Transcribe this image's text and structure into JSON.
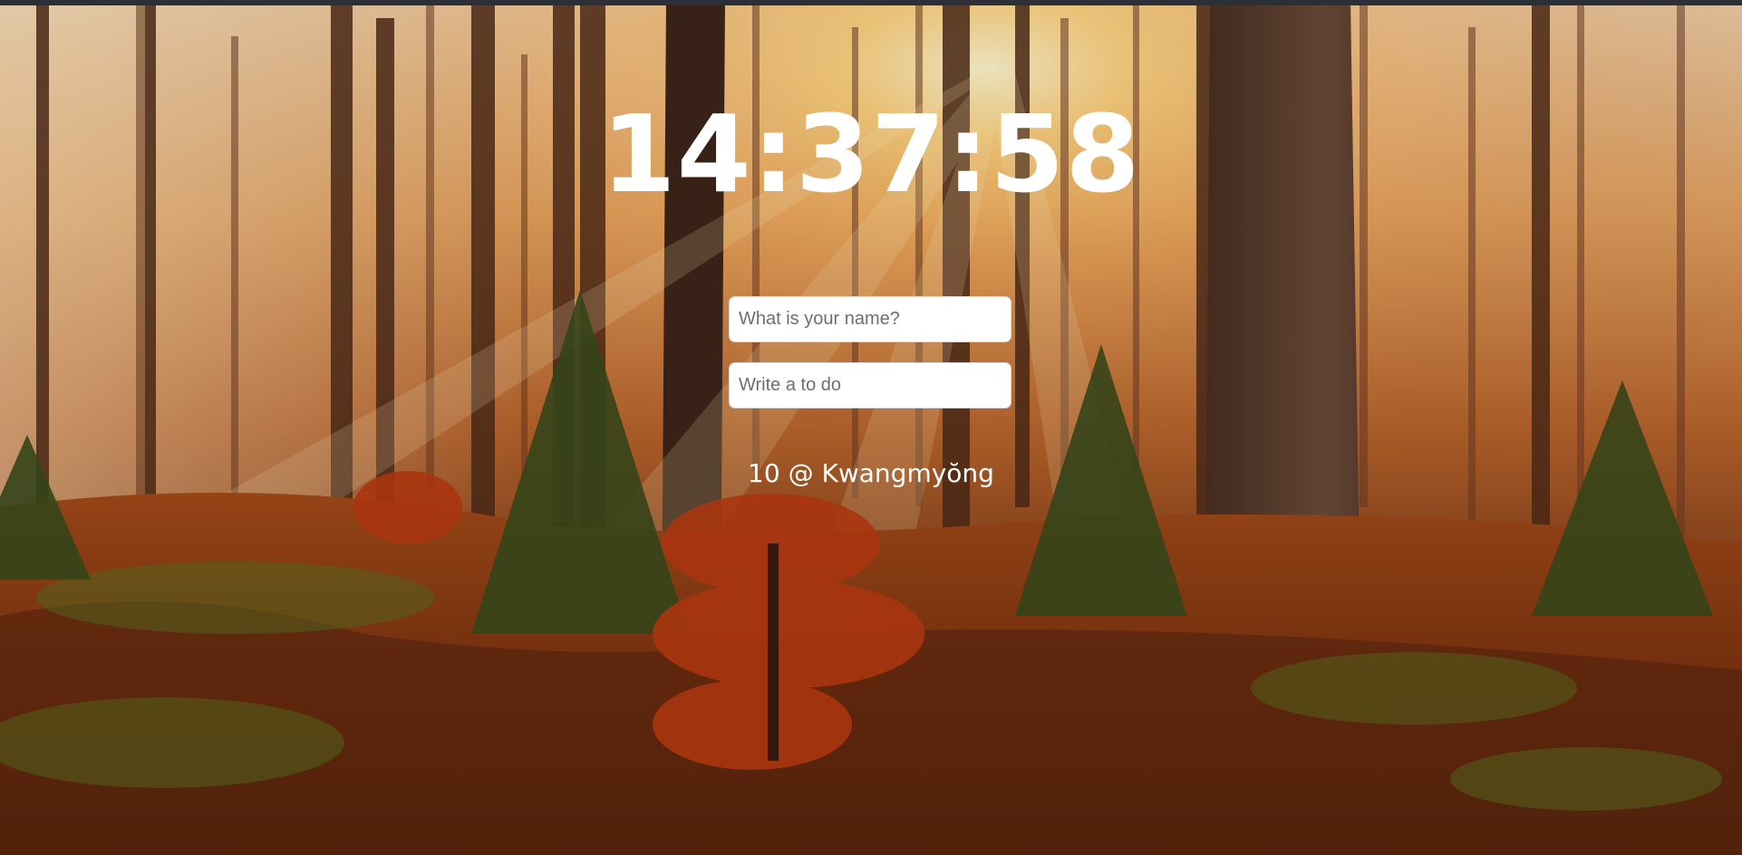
{
  "clock": {
    "time": "14:37:58"
  },
  "form": {
    "name_placeholder": "What is your name?",
    "todo_placeholder": "Write a to do"
  },
  "weather": {
    "temperature": "10",
    "separator": "@",
    "city": "Kwangmyŏng"
  },
  "background": {
    "icon": "forest-sunrise-image"
  }
}
